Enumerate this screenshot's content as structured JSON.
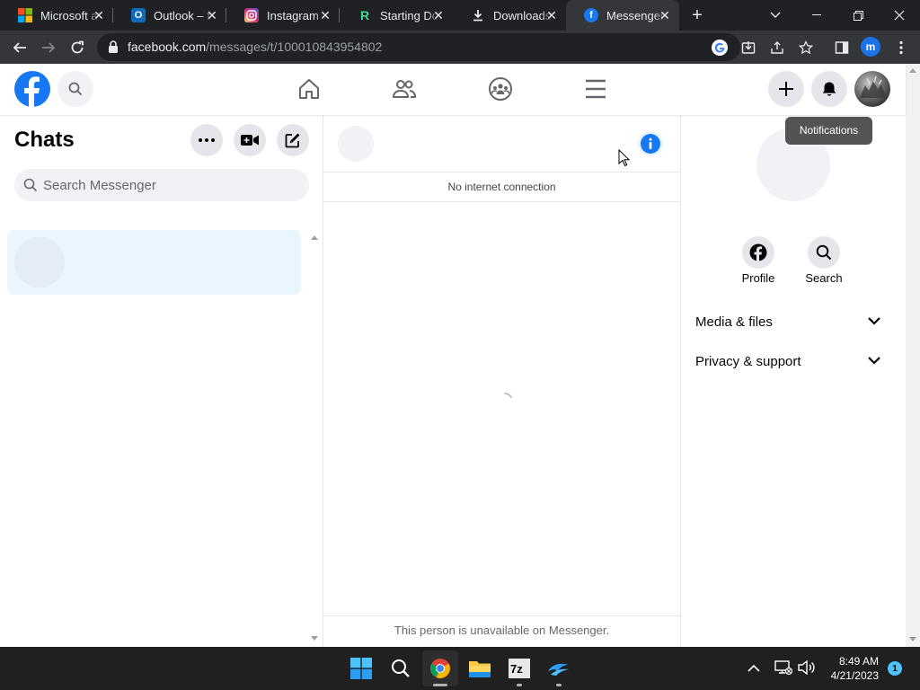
{
  "browser": {
    "tabs": [
      {
        "title": "Microsoft a",
        "icon": "microsoft-logo-icon",
        "active": false
      },
      {
        "title": "Outlook – f",
        "icon": "outlook-icon",
        "active": false
      },
      {
        "title": "Instagram -",
        "icon": "instagram-icon",
        "active": false
      },
      {
        "title": "Starting Do",
        "icon": "r-app-icon",
        "active": false
      },
      {
        "title": "Downloads",
        "icon": "download-icon",
        "active": false
      },
      {
        "title": "Messenger",
        "icon": "facebook-icon",
        "active": true
      }
    ],
    "url_host": "facebook.com",
    "url_path": "/messages/t/100010843954802",
    "profile_initial": "m"
  },
  "facebook": {
    "chats_title": "Chats",
    "search_placeholder": "Search Messenger",
    "no_connection": "No internet connection",
    "unavailable": "This person is unavailable on Messenger.",
    "tooltip": "Notifications",
    "actions": [
      {
        "label": "Profile",
        "icon": "facebook-icon"
      },
      {
        "label": "Search",
        "icon": "search-icon"
      }
    ],
    "sections": [
      {
        "label": "Media & files"
      },
      {
        "label": "Privacy & support"
      }
    ],
    "accent_color": "#1877f2"
  },
  "taskbar": {
    "time": "8:49 AM",
    "date": "4/21/2023",
    "notification_count": "1"
  }
}
